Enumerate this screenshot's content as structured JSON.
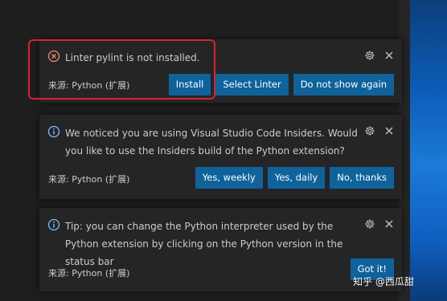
{
  "notifications": [
    {
      "type": "error",
      "icon": "error-circle-icon",
      "message": "Linter pylint is not installed.",
      "source": "来源: Python (扩展)",
      "buttons": [
        "Install",
        "Select Linter",
        "Do not show again"
      ]
    },
    {
      "type": "info",
      "icon": "info-circle-icon",
      "message": "We noticed you are using Visual Studio Code Insiders. Would you like to use the Insiders build of the Python extension?",
      "source": "来源: Python (扩展)",
      "buttons": [
        "Yes, weekly",
        "Yes, daily",
        "No, thanks"
      ]
    },
    {
      "type": "info",
      "icon": "info-circle-icon",
      "message": "Tip: you can change the Python interpreter used by the Python extension by clicking on the Python version in the status bar",
      "source": "来源: Python (扩展)",
      "buttons": [
        "Got it!"
      ]
    }
  ],
  "watermark": "知乎 @西瓜甜",
  "colors": {
    "toast_bg": "#252526",
    "button_bg": "#0e639c",
    "error_icon": "#f48771",
    "info_icon": "#75beff",
    "highlight": "#e0202b"
  }
}
